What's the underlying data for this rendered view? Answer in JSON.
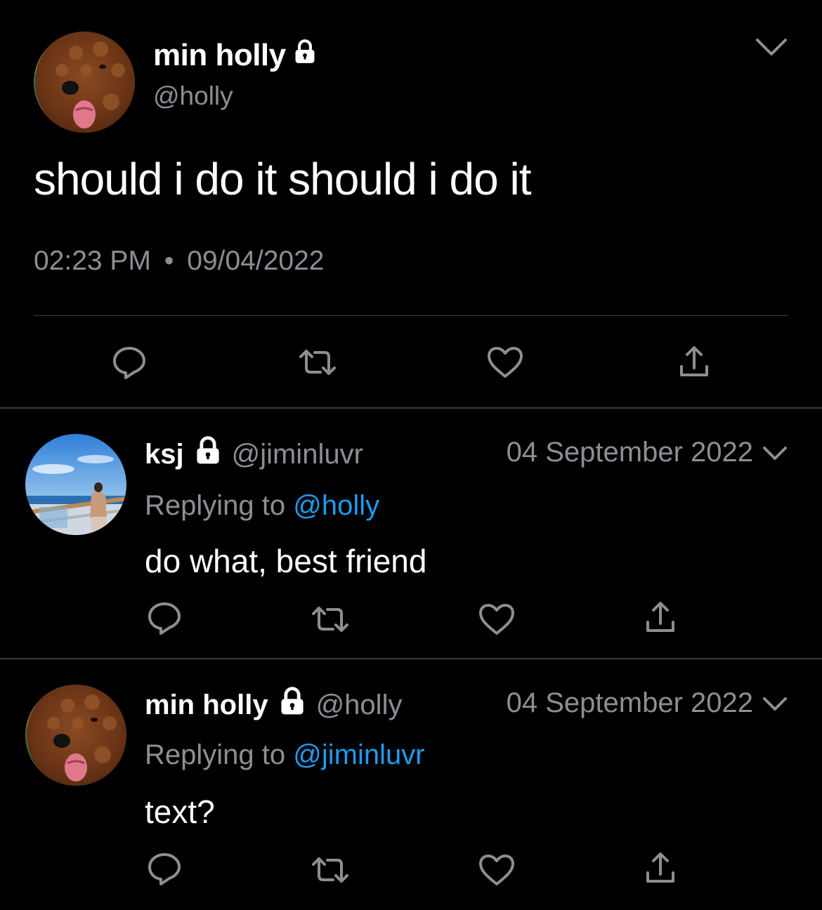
{
  "main_tweet": {
    "display_name": "min holly",
    "handle": "@holly",
    "text": "should i do it should i do it",
    "time": "02:23 PM",
    "separator": "•",
    "date": "09/04/2022"
  },
  "replies": [
    {
      "display_name": "ksj",
      "handle": "@jiminluvr",
      "date": "04 September 2022",
      "replying_prefix": "Replying to",
      "replying_to": "@holly",
      "text": "do what, best friend"
    },
    {
      "display_name": "min holly",
      "handle": "@holly",
      "date": "04 September 2022",
      "replying_prefix": "Replying to",
      "replying_to": "@jiminluvr",
      "text": "text?"
    }
  ],
  "icons": [
    "lock-icon",
    "chevron-down-icon",
    "reply-icon",
    "retweet-icon",
    "like-icon",
    "share-icon"
  ],
  "colors": {
    "background": "#000000",
    "text": "#ffffff",
    "secondary_text": "#8b8f94",
    "mention": "#1d9bf0",
    "divider": "#3a3c40"
  }
}
